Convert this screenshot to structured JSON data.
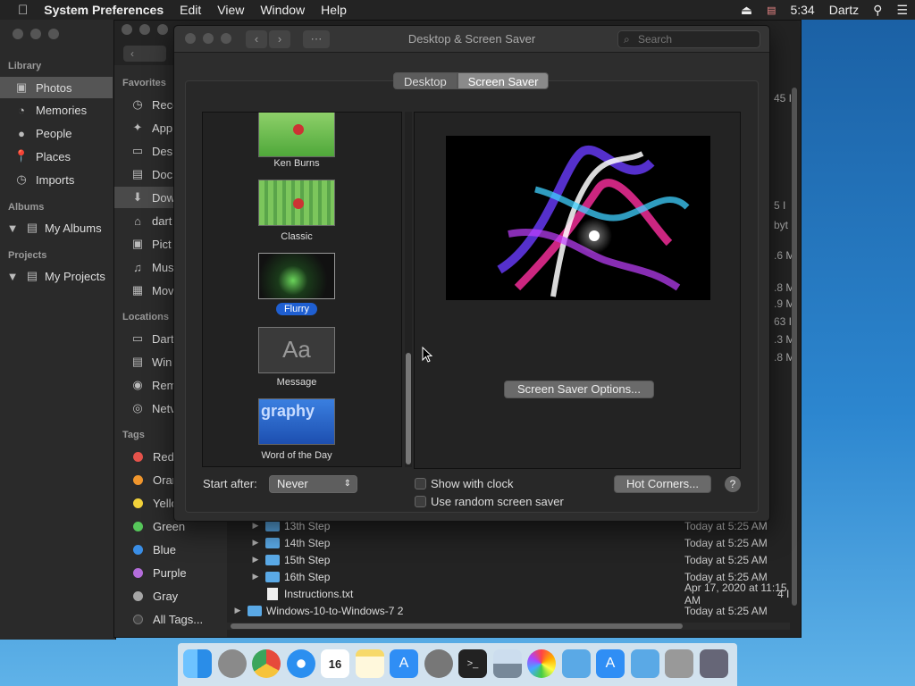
{
  "menubar": {
    "app": "System Preferences",
    "menus": [
      "Edit",
      "View",
      "Window",
      "Help"
    ],
    "time": "5:34",
    "user": "Dartz"
  },
  "photos": {
    "library_title": "Library",
    "library_items": [
      "Photos",
      "Memories",
      "People",
      "Places",
      "Imports"
    ],
    "albums_title": "Albums",
    "albums_item": "My Albums",
    "projects_title": "Projects",
    "projects_item": "My Projects"
  },
  "finder": {
    "favorites_title": "Favorites",
    "favorites": [
      "Rece",
      "App",
      "Des",
      "Doc",
      "Dow",
      "dart",
      "Pict",
      "Mus",
      "Mov"
    ],
    "locations_title": "Locations",
    "locations": [
      "Dart",
      "Win",
      "Rem",
      "Netv"
    ],
    "tags_title": "Tags",
    "tags": [
      {
        "name": "Red",
        "color": "#e5534b"
      },
      {
        "name": "Oran",
        "color": "#f0962d"
      },
      {
        "name": "Yello",
        "color": "#f2d13a"
      },
      {
        "name": "Green",
        "color": "#56c65a"
      },
      {
        "name": "Blue",
        "color": "#3a8ee6"
      },
      {
        "name": "Purple",
        "color": "#b46ddb"
      },
      {
        "name": "Gray",
        "color": "#a6a6a6"
      }
    ],
    "all_tags": "All Tags...",
    "right_col": [
      "45 I",
      "5 I",
      "byt",
      ".6 M",
      ".8 M",
      ".9 M",
      "63 I",
      ".3 M",
      ".8 M"
    ],
    "rows": [
      {
        "name": "13th Step",
        "date": "Today at 5:25 AM",
        "type": "folder",
        "size": ""
      },
      {
        "name": "14th Step",
        "date": "Today at 5:25 AM",
        "type": "folder",
        "size": ""
      },
      {
        "name": "15th Step",
        "date": "Today at 5:25 AM",
        "type": "folder",
        "size": ""
      },
      {
        "name": "16th Step",
        "date": "Today at 5:25 AM",
        "type": "folder",
        "size": ""
      },
      {
        "name": "Instructions.txt",
        "date": "Apr 17, 2020 at 11:15 AM",
        "type": "file",
        "size": "4 I"
      },
      {
        "name": "Windows-10-to-Windows-7 2",
        "date": "Today at 5:25 AM",
        "type": "folder",
        "size": ""
      }
    ]
  },
  "syspref": {
    "title": "Desktop & Screen Saver",
    "search_placeholder": "Search",
    "tab_desktop": "Desktop",
    "tab_screensaver": "Screen Saver",
    "savers": [
      {
        "label": "Ken Burns"
      },
      {
        "label": "Classic"
      },
      {
        "label": "Flurry"
      },
      {
        "label": "Message",
        "tile_text": "Aa"
      },
      {
        "label": "Word of the Day",
        "tile_text": "graphy"
      }
    ],
    "options_button": "Screen Saver Options...",
    "start_after_label": "Start after:",
    "start_after_value": "Never",
    "show_clock": "Show with clock",
    "random_saver": "Use random screen saver",
    "hot_corners": "Hot Corners...",
    "help": "?"
  },
  "dock": {
    "apps": [
      "finder-icon",
      "launchpad-icon",
      "chrome-icon",
      "safari-icon",
      "calendar-icon",
      "notes-icon",
      "appstore-icon",
      "sysprefs-icon",
      "terminal-icon",
      "preview-icon",
      "photos-icon",
      "folder-icon",
      "appstore-icon",
      "folder-icon",
      "trash-icon",
      "rocket-icon"
    ],
    "calendar_day": "16"
  }
}
